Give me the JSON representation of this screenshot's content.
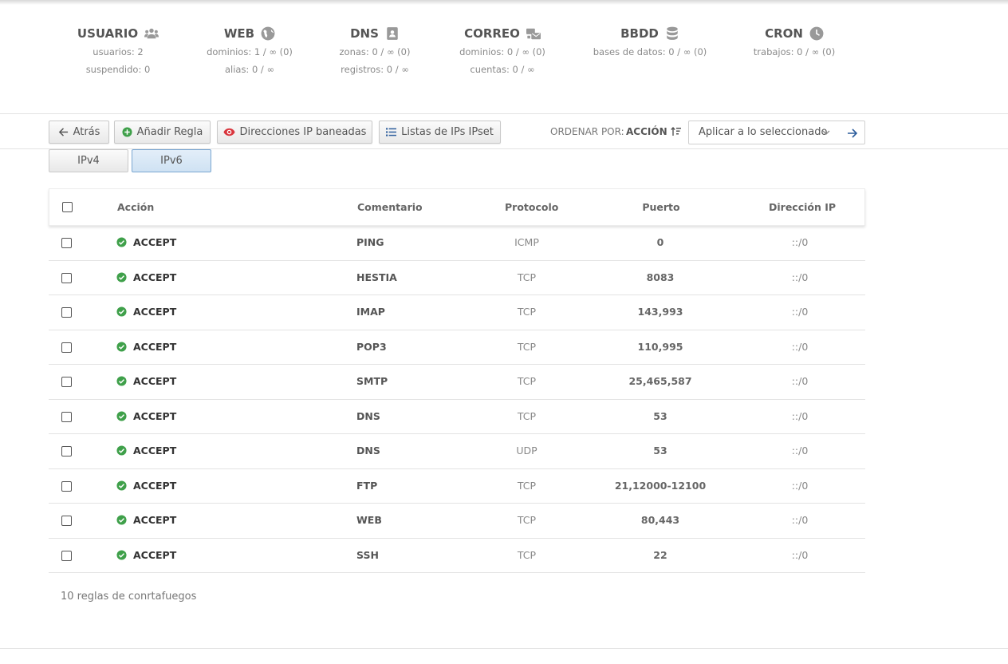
{
  "stats": [
    {
      "title": "USUARIO",
      "icon": "users-icon",
      "lines": [
        "usuarios: 2",
        "suspendido: 0"
      ]
    },
    {
      "title": "WEB",
      "icon": "globe-icon",
      "lines": [
        "dominios: 1 / ∞ (0)",
        "alias: 0 / ∞"
      ]
    },
    {
      "title": "DNS",
      "icon": "address-book-icon",
      "lines": [
        "zonas: 0 / ∞ (0)",
        "registros: 0 / ∞"
      ]
    },
    {
      "title": "CORREO",
      "icon": "mail-bulk-icon",
      "lines": [
        "dominios: 0 / ∞ (0)",
        "cuentas: 0 / ∞"
      ]
    },
    {
      "title": "BBDD",
      "icon": "database-icon",
      "lines": [
        "bases de datos: 0 / ∞ (0)"
      ]
    },
    {
      "title": "CRON",
      "icon": "clock-icon",
      "lines": [
        "trabajos: 0 / ∞ (0)"
      ]
    }
  ],
  "toolbar": {
    "back": "Atrás",
    "add_rule": "Añadir Regla",
    "banned_ips": "Direcciones IP baneadas",
    "ipset": "Listas de IPs IPset",
    "sort_label": "ORDENAR POR:",
    "sort_value": "ACCIÓN",
    "bulk_action": "Aplicar a lo seleccionado"
  },
  "tabs": [
    "IPv4",
    "IPv6"
  ],
  "active_tab": "IPv6",
  "colors": {
    "accent_green": "#3fa04a",
    "banned_red": "#d9363e",
    "ipset_blue": "#2c5d9c",
    "active_tab_bg": "#d6e7f6"
  },
  "table": {
    "headers": [
      "Acción",
      "Comentario",
      "Protocolo",
      "Puerto",
      "Dirección IP"
    ],
    "rows": [
      {
        "action": "ACCEPT",
        "comment": "PING",
        "protocol": "ICMP",
        "port": "0",
        "ip": "::/0"
      },
      {
        "action": "ACCEPT",
        "comment": "HESTIA",
        "protocol": "TCP",
        "port": "8083",
        "ip": "::/0"
      },
      {
        "action": "ACCEPT",
        "comment": "IMAP",
        "protocol": "TCP",
        "port": "143,993",
        "ip": "::/0"
      },
      {
        "action": "ACCEPT",
        "comment": "POP3",
        "protocol": "TCP",
        "port": "110,995",
        "ip": "::/0"
      },
      {
        "action": "ACCEPT",
        "comment": "SMTP",
        "protocol": "TCP",
        "port": "25,465,587",
        "ip": "::/0"
      },
      {
        "action": "ACCEPT",
        "comment": "DNS",
        "protocol": "TCP",
        "port": "53",
        "ip": "::/0"
      },
      {
        "action": "ACCEPT",
        "comment": "DNS",
        "protocol": "UDP",
        "port": "53",
        "ip": "::/0"
      },
      {
        "action": "ACCEPT",
        "comment": "FTP",
        "protocol": "TCP",
        "port": "21,12000-12100",
        "ip": "::/0"
      },
      {
        "action": "ACCEPT",
        "comment": "WEB",
        "protocol": "TCP",
        "port": "80,443",
        "ip": "::/0"
      },
      {
        "action": "ACCEPT",
        "comment": "SSH",
        "protocol": "TCP",
        "port": "22",
        "ip": "::/0"
      }
    ]
  },
  "footer": "10 reglas de conrtafuegos"
}
